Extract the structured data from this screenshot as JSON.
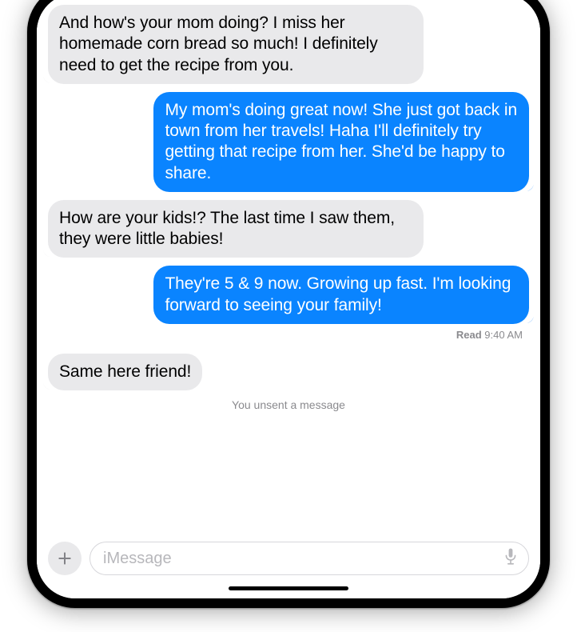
{
  "messages": {
    "m0": "And how's your mom doing? I miss her homemade corn bread so much! I definitely need to get the recipe from you.",
    "m1": "My mom's doing great now! She just got back in town from her travels! Haha I'll definitely try getting that recipe from her. She'd be happy to share.",
    "m2": "How are your kids!? The last time I saw them, they were little babies!",
    "m3": "They're 5 & 9 now. Growing up fast. I'm looking forward to seeing your family!",
    "m4": "Same here friend!"
  },
  "receipt": {
    "status": "Read",
    "time": "9:40 AM"
  },
  "systemNote": "You unsent a message",
  "composer": {
    "placeholder": "iMessage"
  }
}
